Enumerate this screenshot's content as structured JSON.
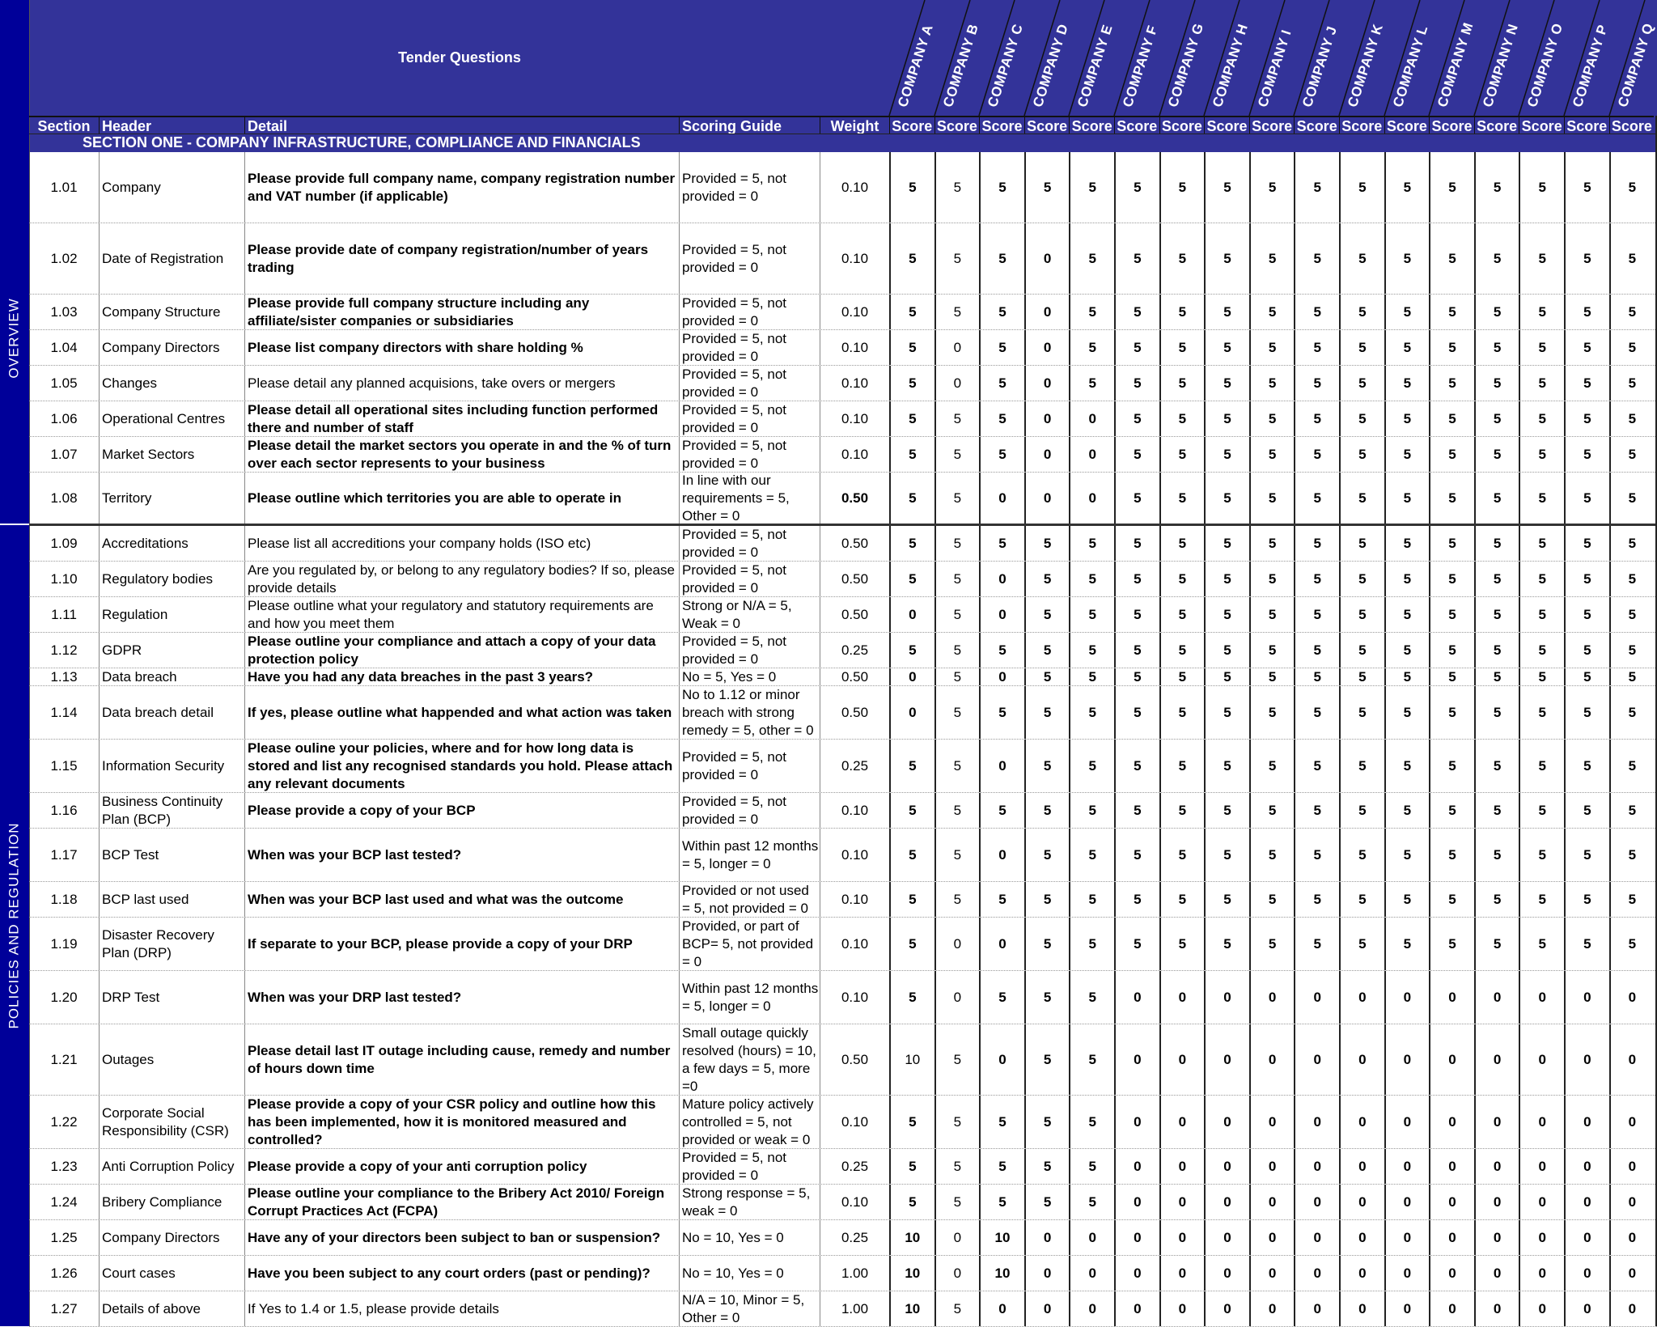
{
  "sheet": {
    "title": "Tender Questions",
    "columns": {
      "section": "Section",
      "header": "Header",
      "detail": "Detail",
      "scoring_guide": "Scoring Guide",
      "weight": "Weight",
      "score": "Score"
    },
    "section_title": "SECTION ONE - COMPANY INFRASTRUCTURE, COMPLIANCE AND FINANCIALS",
    "groups": [
      "OVERVIEW",
      "POLICIES AND REGULATION"
    ],
    "companies": [
      "COMPANY A",
      "COMPANY B",
      "COMPANY C",
      "COMPANY D",
      "COMPANY E",
      "COMPANY F",
      "COMPANY G",
      "COMPANY H",
      "COMPANY I",
      "COMPANY J",
      "COMPANY K",
      "COMPANY L",
      "COMPANY M",
      "COMPANY N",
      "COMPANY O",
      "COMPANY P",
      "COMPANY Q"
    ],
    "colors": {
      "header_bg": "#333399",
      "band_bg": "#000099",
      "header_text": "#ffffff"
    },
    "rows": [
      {
        "section": "1.01",
        "header": "Company",
        "detail": "Please provide full company name, company registration number and VAT number (if applicable)",
        "detail_bold": true,
        "guide": "Provided = 5, not provided = 0",
        "weight": "0.10",
        "weight_bold": false,
        "scores": [
          5,
          5,
          5,
          5,
          5,
          5,
          5,
          5,
          5,
          5,
          5,
          5,
          5,
          5,
          5,
          5,
          5
        ]
      },
      {
        "section": "1.02",
        "header": "Date of Registration",
        "detail": "Please provide date of company registration/number of years trading",
        "detail_bold": true,
        "guide": "Provided = 5, not provided = 0",
        "weight": "0.10",
        "weight_bold": false,
        "scores": [
          5,
          5,
          5,
          0,
          5,
          5,
          5,
          5,
          5,
          5,
          5,
          5,
          5,
          5,
          5,
          5,
          5
        ]
      },
      {
        "section": "1.03",
        "header": "Company Structure",
        "detail": "Please provide full company structure including any affiliate/sister companies or subsidiaries",
        "detail_bold": true,
        "guide": "Provided = 5, not provided = 0",
        "weight": "0.10",
        "weight_bold": false,
        "scores": [
          5,
          5,
          5,
          0,
          5,
          5,
          5,
          5,
          5,
          5,
          5,
          5,
          5,
          5,
          5,
          5,
          5
        ]
      },
      {
        "section": "1.04",
        "header": "Company Directors",
        "detail": "Please list company directors with share holding %",
        "detail_bold": true,
        "guide": "Provided = 5, not provided = 0",
        "weight": "0.10",
        "weight_bold": false,
        "scores": [
          5,
          0,
          5,
          0,
          5,
          5,
          5,
          5,
          5,
          5,
          5,
          5,
          5,
          5,
          5,
          5,
          5
        ]
      },
      {
        "section": "1.05",
        "header": "Changes",
        "detail": "Please detail any planned acquisions, take overs or mergers",
        "detail_bold": false,
        "guide": "Provided = 5, not provided = 0",
        "weight": "0.10",
        "weight_bold": false,
        "scores": [
          5,
          0,
          5,
          0,
          5,
          5,
          5,
          5,
          5,
          5,
          5,
          5,
          5,
          5,
          5,
          5,
          5
        ]
      },
      {
        "section": "1.06",
        "header": "Operational Centres",
        "detail": "Please detail all operational sites including function performed there and number of staff",
        "detail_bold": true,
        "guide": "Provided = 5, not provided = 0",
        "weight": "0.10",
        "weight_bold": false,
        "scores": [
          5,
          5,
          5,
          0,
          0,
          5,
          5,
          5,
          5,
          5,
          5,
          5,
          5,
          5,
          5,
          5,
          5
        ]
      },
      {
        "section": "1.07",
        "header": "Market Sectors",
        "detail": "Please detail the market sectors you operate in and the % of turn over each sector represents to your business",
        "detail_bold": true,
        "guide": "Provided = 5, not provided = 0",
        "weight": "0.10",
        "weight_bold": false,
        "scores": [
          5,
          5,
          5,
          0,
          0,
          5,
          5,
          5,
          5,
          5,
          5,
          5,
          5,
          5,
          5,
          5,
          5
        ]
      },
      {
        "section": "1.08",
        "header": "Territory",
        "detail": "Please outline which territories you are able to operate in",
        "detail_bold": true,
        "guide": "In line with our requirements = 5, Other = 0",
        "weight": "0.50",
        "weight_bold": true,
        "scores": [
          5,
          5,
          0,
          0,
          0,
          5,
          5,
          5,
          5,
          5,
          5,
          5,
          5,
          5,
          5,
          5,
          5
        ]
      },
      {
        "section": "1.09",
        "header": "Accreditations",
        "detail": "Please list all accreditions your company holds (ISO etc)",
        "detail_bold": false,
        "guide": "Provided = 5, not provided = 0",
        "weight": "0.50",
        "weight_bold": false,
        "scores": [
          5,
          5,
          5,
          5,
          5,
          5,
          5,
          5,
          5,
          5,
          5,
          5,
          5,
          5,
          5,
          5,
          5
        ]
      },
      {
        "section": "1.10",
        "header": "Regulatory bodies",
        "detail": "Are you regulated by, or belong to any regulatory bodies? If so, please provide details",
        "detail_bold": false,
        "guide": "Provided = 5, not provided = 0",
        "weight": "0.50",
        "weight_bold": false,
        "scores": [
          5,
          5,
          0,
          5,
          5,
          5,
          5,
          5,
          5,
          5,
          5,
          5,
          5,
          5,
          5,
          5,
          5
        ]
      },
      {
        "section": "1.11",
        "header": "Regulation",
        "detail": "Please outline what your regulatory and statutory requirements are and how you meet them",
        "detail_bold": false,
        "guide": "Strong or N/A = 5, Weak = 0",
        "weight": "0.50",
        "weight_bold": false,
        "scores": [
          0,
          5,
          0,
          5,
          5,
          5,
          5,
          5,
          5,
          5,
          5,
          5,
          5,
          5,
          5,
          5,
          5
        ]
      },
      {
        "section": "1.12",
        "header": "GDPR",
        "detail": "Please outline your compliance and attach a copy of your data protection policy",
        "detail_bold": true,
        "guide": "Provided = 5, not provided = 0",
        "weight": "0.25",
        "weight_bold": false,
        "scores": [
          5,
          5,
          5,
          5,
          5,
          5,
          5,
          5,
          5,
          5,
          5,
          5,
          5,
          5,
          5,
          5,
          5
        ]
      },
      {
        "section": "1.13",
        "header": "Data breach",
        "detail": "Have you had any data breaches in the past 3 years?",
        "detail_bold": true,
        "guide": "No = 5, Yes = 0",
        "weight": "0.50",
        "weight_bold": false,
        "scores": [
          0,
          5,
          0,
          5,
          5,
          5,
          5,
          5,
          5,
          5,
          5,
          5,
          5,
          5,
          5,
          5,
          5
        ]
      },
      {
        "section": "1.14",
        "header": "Data breach detail",
        "detail": "If yes, please outline what happended and what action was taken",
        "detail_bold": true,
        "guide": "No to 1.12 or minor breach with strong remedy = 5, other = 0",
        "weight": "0.50",
        "weight_bold": false,
        "scores": [
          0,
          5,
          5,
          5,
          5,
          5,
          5,
          5,
          5,
          5,
          5,
          5,
          5,
          5,
          5,
          5,
          5
        ]
      },
      {
        "section": "1.15",
        "header": "Information Security",
        "detail": "Please ouline your policies, where and for how long data is stored and list any recognised standards you hold. Please attach any relevant documents",
        "detail_bold": true,
        "guide": "Provided = 5, not provided = 0",
        "weight": "0.25",
        "weight_bold": false,
        "scores": [
          5,
          5,
          0,
          5,
          5,
          5,
          5,
          5,
          5,
          5,
          5,
          5,
          5,
          5,
          5,
          5,
          5
        ]
      },
      {
        "section": "1.16",
        "header": "Business Continuity Plan (BCP)",
        "detail": "Please provide a copy of your BCP",
        "detail_bold": true,
        "guide": "Provided = 5, not provided = 0",
        "weight": "0.10",
        "weight_bold": false,
        "scores": [
          5,
          5,
          5,
          5,
          5,
          5,
          5,
          5,
          5,
          5,
          5,
          5,
          5,
          5,
          5,
          5,
          5
        ]
      },
      {
        "section": "1.17",
        "header": "BCP Test",
        "detail": "When was your BCP last tested?",
        "detail_bold": true,
        "guide": "Within past 12 months = 5, longer = 0",
        "weight": "0.10",
        "weight_bold": false,
        "scores": [
          5,
          5,
          0,
          5,
          5,
          5,
          5,
          5,
          5,
          5,
          5,
          5,
          5,
          5,
          5,
          5,
          5
        ]
      },
      {
        "section": "1.18",
        "header": "BCP last used",
        "detail": "When was your BCP last used and what was the outcome",
        "detail_bold": true,
        "guide": "Provided or not used = 5, not provided = 0",
        "weight": "0.10",
        "weight_bold": false,
        "scores": [
          5,
          5,
          5,
          5,
          5,
          5,
          5,
          5,
          5,
          5,
          5,
          5,
          5,
          5,
          5,
          5,
          5
        ]
      },
      {
        "section": "1.19",
        "header": "Disaster Recovery Plan (DRP)",
        "detail": "If separate to your BCP, please provide a copy of your DRP",
        "detail_bold": true,
        "guide": "Provided, or part of BCP= 5, not provided = 0",
        "weight": "0.10",
        "weight_bold": false,
        "scores": [
          5,
          0,
          0,
          5,
          5,
          5,
          5,
          5,
          5,
          5,
          5,
          5,
          5,
          5,
          5,
          5,
          5
        ]
      },
      {
        "section": "1.20",
        "header": "DRP Test",
        "detail": "When was your DRP last tested?",
        "detail_bold": true,
        "guide": "Within past 12 months = 5, longer = 0",
        "weight": "0.10",
        "weight_bold": false,
        "scores": [
          5,
          0,
          5,
          5,
          5,
          0,
          0,
          0,
          0,
          0,
          0,
          0,
          0,
          0,
          0,
          0,
          0
        ]
      },
      {
        "section": "1.21",
        "header": "Outages",
        "detail": "Please detail last IT outage including cause, remedy and number of hours down time",
        "detail_bold": true,
        "guide": "Small outage quickly resolved (hours) = 10, a few days = 5, more =0",
        "weight": "0.50",
        "weight_bold": false,
        "scores": [
          10,
          5,
          0,
          5,
          5,
          0,
          0,
          0,
          0,
          0,
          0,
          0,
          0,
          0,
          0,
          0,
          0
        ]
      },
      {
        "section": "1.22",
        "header": "Corporate Social Responsibility (CSR)",
        "detail": "Please provide a copy of your CSR policy and outline how this has been implemented, how it is monitored measured and controlled?",
        "detail_bold": true,
        "guide": "Mature policy actively controlled = 5, not provided or weak = 0",
        "weight": "0.10",
        "weight_bold": false,
        "scores": [
          5,
          5,
          5,
          5,
          5,
          0,
          0,
          0,
          0,
          0,
          0,
          0,
          0,
          0,
          0,
          0,
          0
        ]
      },
      {
        "section": "1.23",
        "header": "Anti Corruption Policy",
        "detail": "Please provide a copy of your anti corruption policy",
        "detail_bold": true,
        "guide": "Provided = 5, not provided = 0",
        "weight": "0.25",
        "weight_bold": false,
        "scores": [
          5,
          5,
          5,
          5,
          5,
          0,
          0,
          0,
          0,
          0,
          0,
          0,
          0,
          0,
          0,
          0,
          0
        ]
      },
      {
        "section": "1.24",
        "header": "Bribery Compliance",
        "detail": "Please outline your compliance to the Bribery Act 2010/ Foreign Corrupt Practices Act (FCPA)",
        "detail_bold": true,
        "guide": "Strong response = 5, weak = 0",
        "weight": "0.10",
        "weight_bold": false,
        "scores": [
          5,
          5,
          5,
          5,
          5,
          0,
          0,
          0,
          0,
          0,
          0,
          0,
          0,
          0,
          0,
          0,
          0
        ]
      },
      {
        "section": "1.25",
        "header": "Company Directors",
        "detail": "Have any of your directors been subject to ban or suspension?",
        "detail_bold": true,
        "guide": "No = 10, Yes = 0",
        "weight": "0.25",
        "weight_bold": false,
        "scores": [
          10,
          0,
          10,
          0,
          0,
          0,
          0,
          0,
          0,
          0,
          0,
          0,
          0,
          0,
          0,
          0,
          0
        ]
      },
      {
        "section": "1.26",
        "header": "Court cases",
        "detail": "Have you been subject to any court orders (past or pending)?",
        "detail_bold": true,
        "guide": "No = 10, Yes = 0",
        "weight": "1.00",
        "weight_bold": false,
        "scores": [
          10,
          0,
          10,
          0,
          0,
          0,
          0,
          0,
          0,
          0,
          0,
          0,
          0,
          0,
          0,
          0,
          0
        ]
      },
      {
        "section": "1.27",
        "header": "Details of above",
        "detail": "If Yes to 1.4 or 1.5, please provide details",
        "detail_bold": false,
        "guide": "N/A = 10, Minor = 5, Other = 0",
        "weight": "1.00",
        "weight_bold": false,
        "scores": [
          10,
          5,
          0,
          0,
          0,
          0,
          0,
          0,
          0,
          0,
          0,
          0,
          0,
          0,
          0,
          0,
          0
        ]
      }
    ]
  }
}
